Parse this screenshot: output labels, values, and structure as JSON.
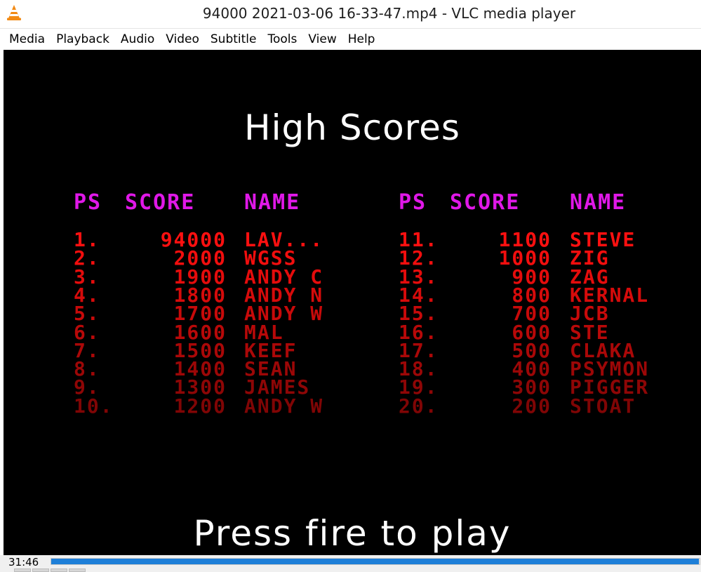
{
  "window": {
    "title": "94000 2021-03-06 16-33-47.mp4 - VLC media player"
  },
  "menu": [
    "Media",
    "Playback",
    "Audio",
    "Video",
    "Subtitle",
    "Tools",
    "View",
    "Help"
  ],
  "game": {
    "title": "High Scores",
    "headers": {
      "ps": "PS",
      "score": "SCORE",
      "name": "NAME"
    },
    "left": [
      {
        "ps": "1.",
        "score": "94000",
        "name": "LAV..."
      },
      {
        "ps": "2.",
        "score": "2000",
        "name": "WGSS"
      },
      {
        "ps": "3.",
        "score": "1900",
        "name": "ANDY C"
      },
      {
        "ps": "4.",
        "score": "1800",
        "name": "ANDY N"
      },
      {
        "ps": "5.",
        "score": "1700",
        "name": "ANDY W"
      },
      {
        "ps": "6.",
        "score": "1600",
        "name": "MAL"
      },
      {
        "ps": "7.",
        "score": "1500",
        "name": "KEEF"
      },
      {
        "ps": "8.",
        "score": "1400",
        "name": "SEAN"
      },
      {
        "ps": "9.",
        "score": "1300",
        "name": "JAMES"
      },
      {
        "ps": "10.",
        "score": "1200",
        "name": "ANDY W"
      }
    ],
    "right": [
      {
        "ps": "11.",
        "score": "1100",
        "name": "STEVE"
      },
      {
        "ps": "12.",
        "score": "1000",
        "name": "ZIG"
      },
      {
        "ps": "13.",
        "score": "900",
        "name": "ZAG"
      },
      {
        "ps": "14.",
        "score": "800",
        "name": "KERNAL"
      },
      {
        "ps": "15.",
        "score": "700",
        "name": "JCB"
      },
      {
        "ps": "16.",
        "score": "600",
        "name": "STE"
      },
      {
        "ps": "17.",
        "score": "500",
        "name": "CLAKA"
      },
      {
        "ps": "18.",
        "score": "400",
        "name": "PSYMON"
      },
      {
        "ps": "19.",
        "score": "300",
        "name": "PIGGER"
      },
      {
        "ps": "20.",
        "score": "200",
        "name": "STOAT"
      }
    ],
    "prompt": "Press fire to play",
    "row_colors": [
      "#ff1010",
      "#f20e0e",
      "#e40c0c",
      "#d60b0b",
      "#c80a0a",
      "#b80909",
      "#aa0808",
      "#9c0707",
      "#8e0606",
      "#800505"
    ],
    "header_color": "#e018e8"
  },
  "status": {
    "elapsed": "31:46",
    "progress": 0.999
  },
  "colors": {
    "accent": "#1e7fd8"
  }
}
